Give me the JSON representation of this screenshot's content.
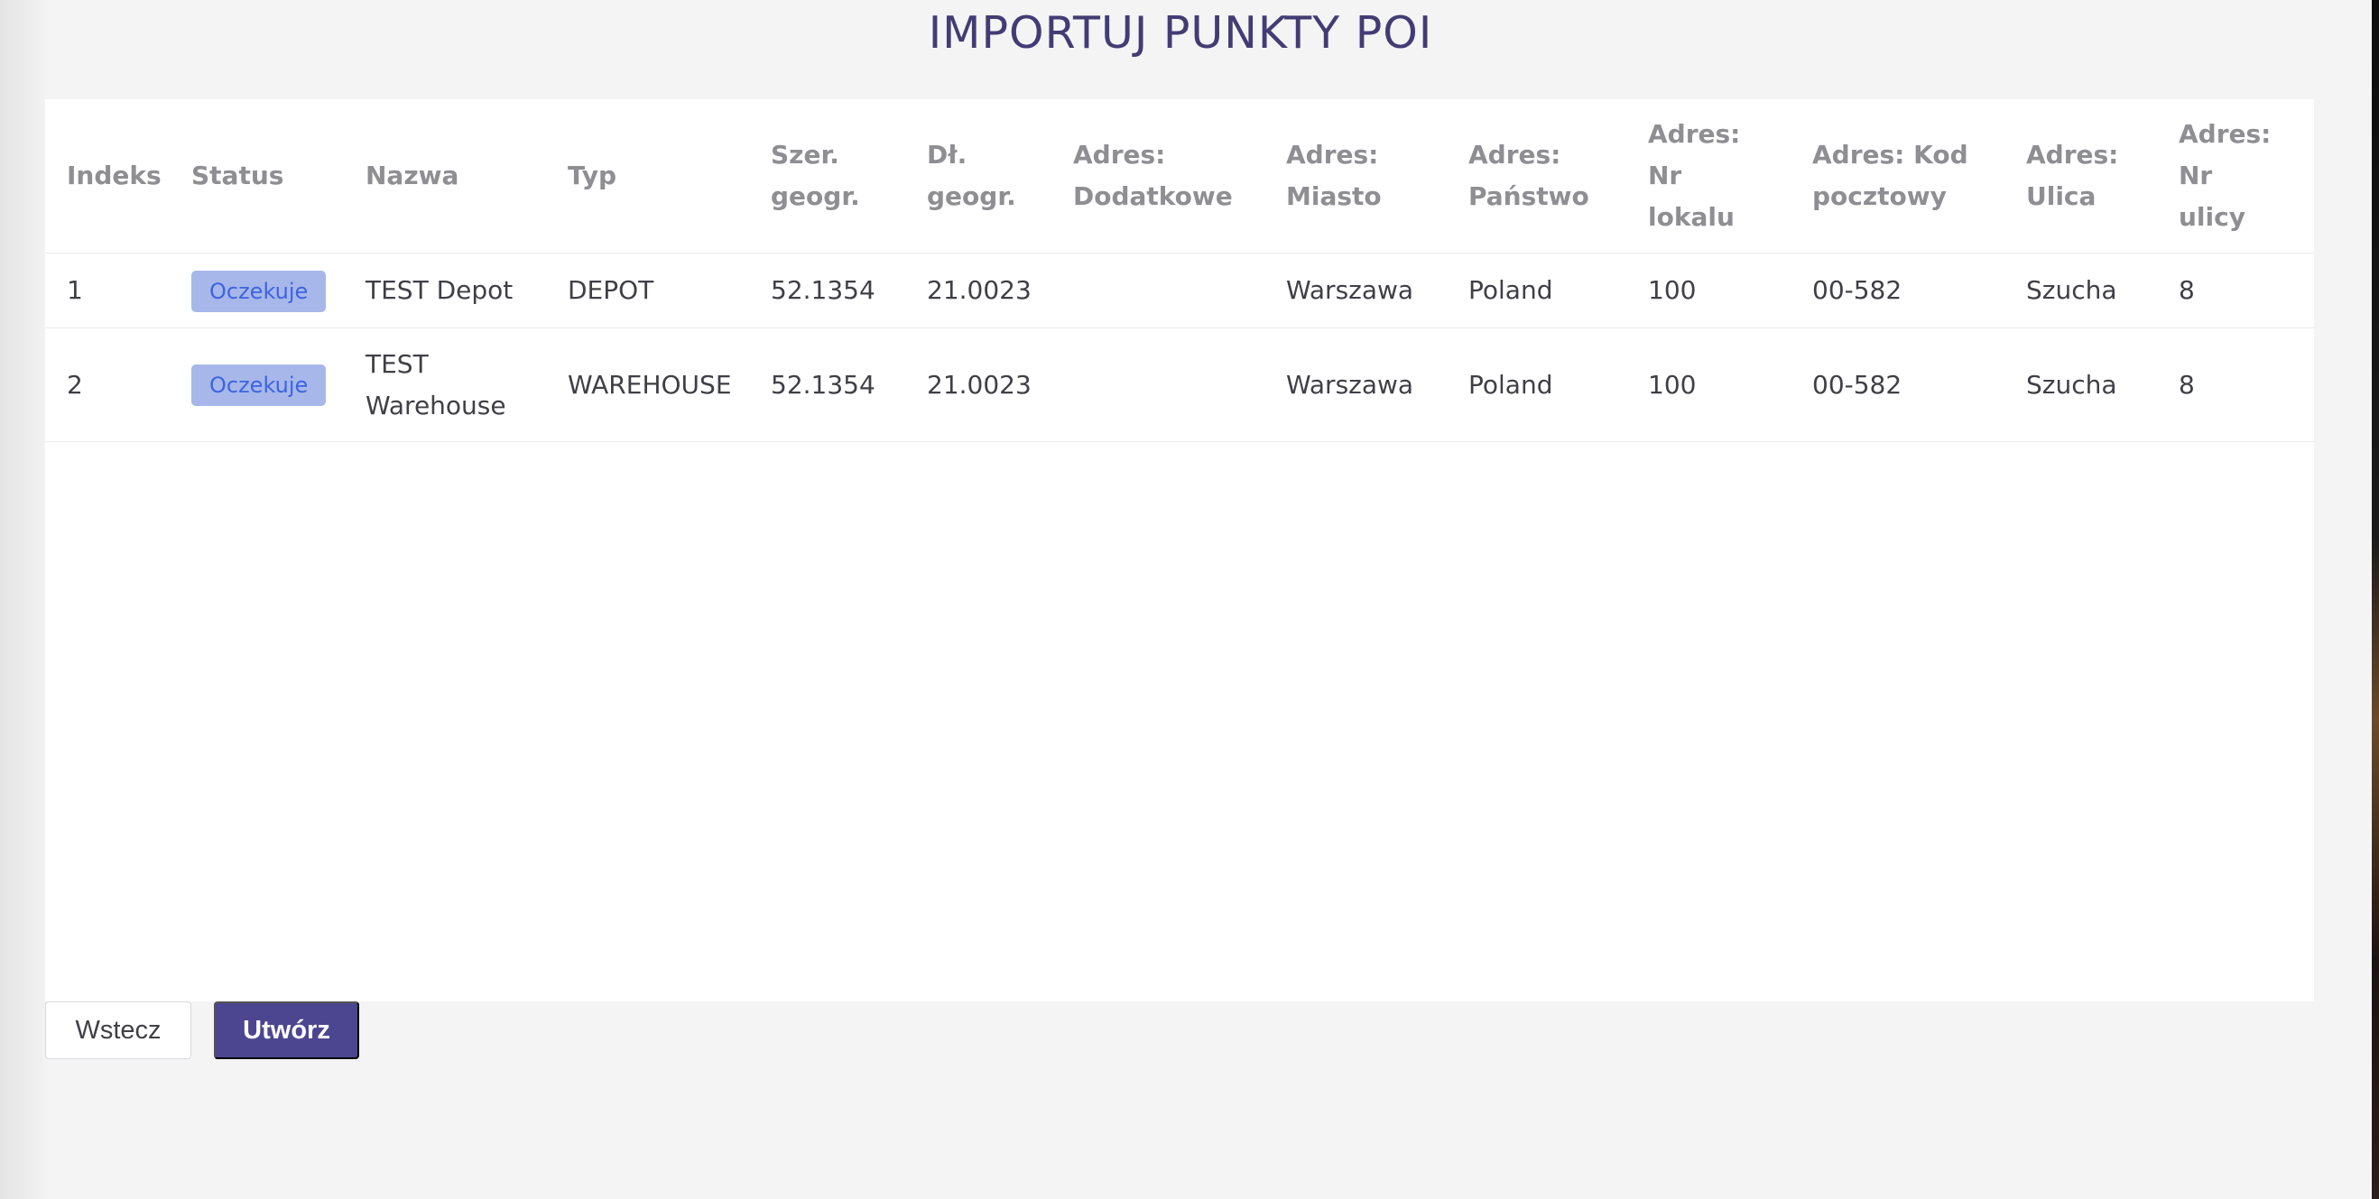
{
  "page": {
    "title": "IMPORTUJ PUNKTY POI"
  },
  "table": {
    "headers": [
      [
        "Indeks"
      ],
      [
        "Status"
      ],
      [
        "Nazwa"
      ],
      [
        "Typ"
      ],
      [
        "Szer.",
        "geogr."
      ],
      [
        "Dł.",
        "geogr."
      ],
      [
        "Adres:",
        "Dodatkowe"
      ],
      [
        "Adres:",
        "Miasto"
      ],
      [
        "Adres:",
        "Państwo"
      ],
      [
        "Adres: Nr",
        "lokalu"
      ],
      [
        "Adres: Kod",
        "pocztowy"
      ],
      [
        "Adres:",
        "Ulica"
      ],
      [
        "Adres: Nr",
        "ulicy"
      ]
    ],
    "rows": [
      {
        "index": "1",
        "status": "Oczekuje",
        "name": "TEST Depot",
        "type": "DEPOT",
        "lat": "52.1354",
        "lng": "21.0023",
        "additional": "",
        "city": "Warszawa",
        "country": "Poland",
        "unit": "100",
        "postal": "00-582",
        "street": "Szucha",
        "street_no": "8"
      },
      {
        "index": "2",
        "status": "Oczekuje",
        "name": "TEST Warehouse",
        "type": "WAREHOUSE",
        "lat": "52.1354",
        "lng": "21.0023",
        "additional": "",
        "city": "Warszawa",
        "country": "Poland",
        "unit": "100",
        "postal": "00-582",
        "street": "Szucha",
        "street_no": "8"
      }
    ]
  },
  "buttons": {
    "back": "Wstecz",
    "create": "Utwórz"
  },
  "colors": {
    "title": "#433c74",
    "primary": "#4c4690",
    "badge_bg": "#a7b7ea",
    "badge_text": "#3d64e0"
  }
}
